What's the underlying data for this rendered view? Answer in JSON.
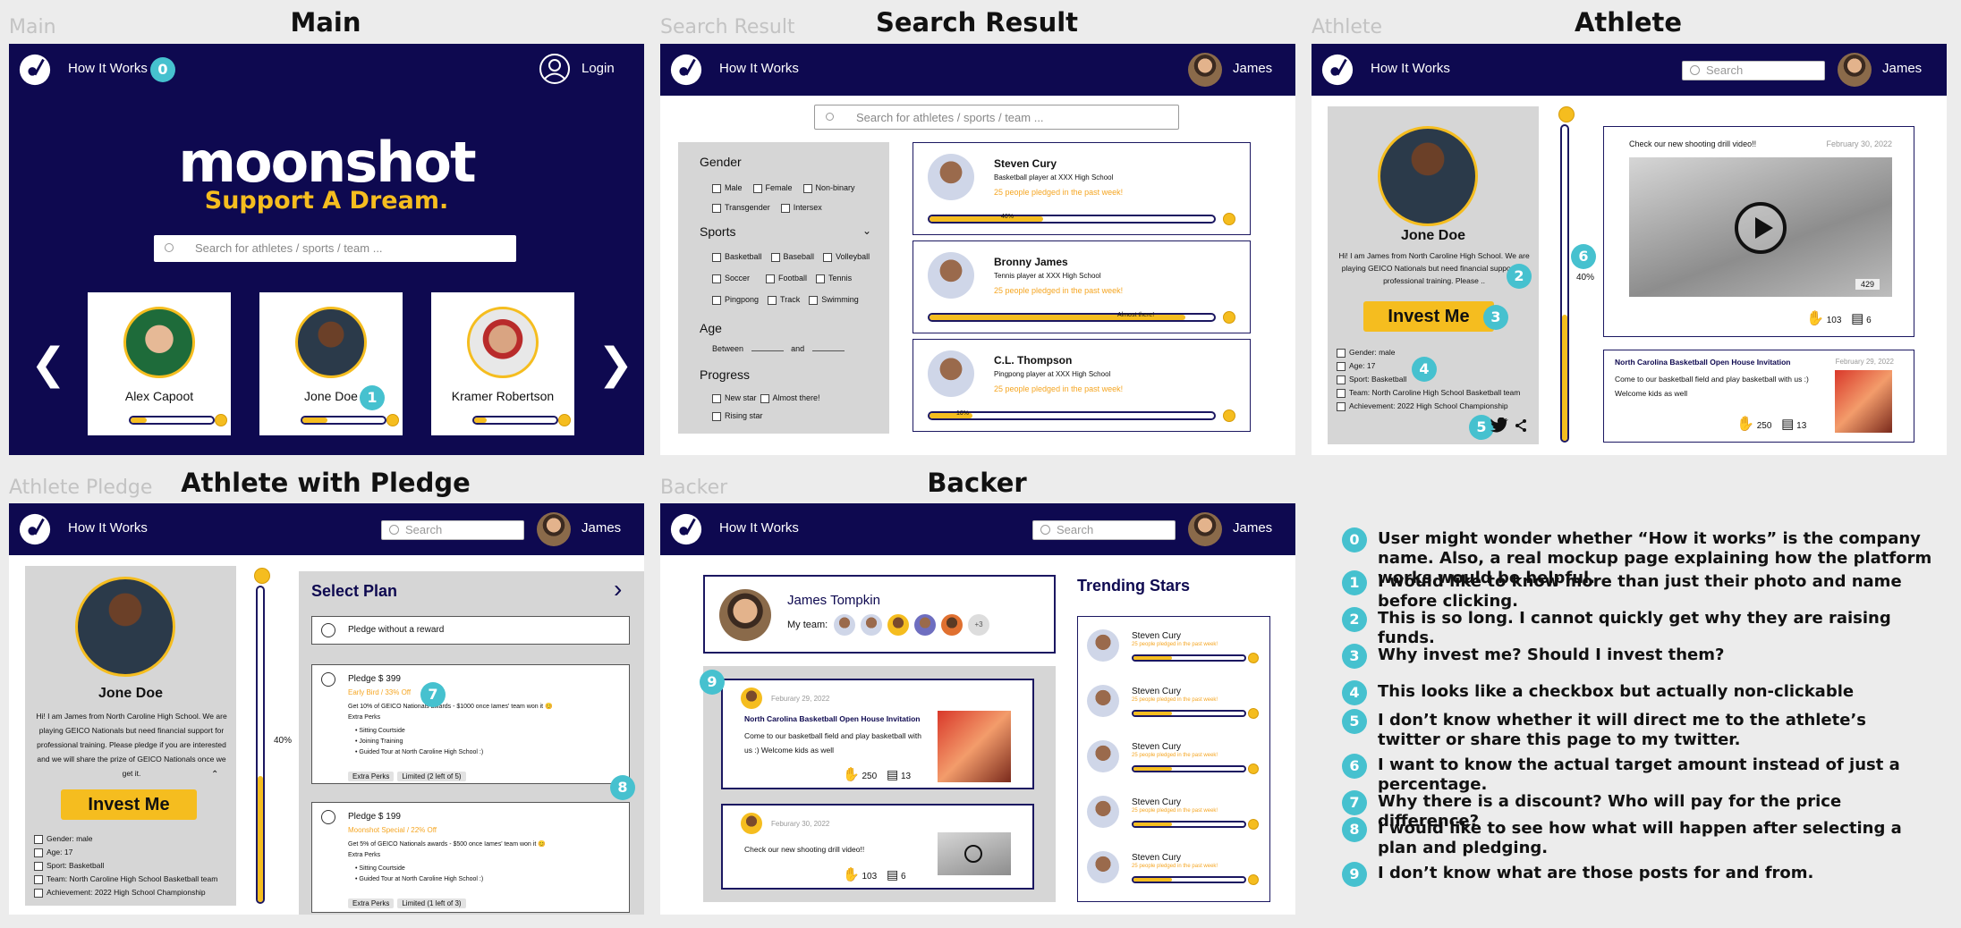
{
  "panels": {
    "main": {
      "label": "Main",
      "title": "Main"
    },
    "search": {
      "label": "Search Result",
      "title": "Search Result"
    },
    "athlete": {
      "label": "Athlete",
      "title": "Athlete"
    },
    "pledge": {
      "label": "Athlete Pledge",
      "title": "Athlete with Pledge"
    },
    "backer": {
      "label": "Backer",
      "title": "Backer"
    }
  },
  "nav": {
    "how_it_works": "How It Works",
    "login": "Login",
    "user": "James",
    "search_placeholder": "Search"
  },
  "main": {
    "brand": "moonshot",
    "tagline": "Support A Dream.",
    "search_placeholder": "Search for athletes / sports / team ...",
    "athletes": [
      "Alex Capoot",
      "Jone Doe",
      "Kramer Robertson"
    ]
  },
  "search": {
    "search_placeholder": "Search for athletes / sports / team ...",
    "filters": {
      "gender_title": "Gender",
      "gender": [
        "Male",
        "Female",
        "Non-binary",
        "Transgender",
        "Intersex"
      ],
      "sports_title": "Sports",
      "sports": [
        "Basketball",
        "Baseball",
        "Volleyball",
        "Soccer",
        "Football",
        "Tennis",
        "Pingpong",
        "Track",
        "Swimming"
      ],
      "age_title": "Age",
      "age_between": "Between",
      "age_and": "and",
      "progress_title": "Progress",
      "progress": [
        "New star",
        "Almost there!",
        "Rising star"
      ]
    },
    "results": [
      {
        "name": "Steven Cury",
        "desc": "Basketball player at XXX High School",
        "pledged": "25 people pledged in the past week!",
        "progress": 0.4,
        "bar_label": "40%"
      },
      {
        "name": "Bronny James",
        "desc": "Tennis player at XXX High School",
        "pledged": "25 people pledged in the past week!",
        "progress": 0.9,
        "bar_label": "Almost there!"
      },
      {
        "name": "C.L. Thompson",
        "desc": "Pingpong player at XXX High School",
        "pledged": "25 people pledged in the past week!",
        "progress": 0.15,
        "bar_label": "10%"
      }
    ]
  },
  "athlete": {
    "name": "Jone Doe",
    "bio": "Hi! I am James from North Caroline High School. We are playing GEICO Nationals but need financial support for professional training. Please ..",
    "invest": "Invest Me",
    "facts": [
      "Gender: male",
      "Age: 17",
      "Sport: Basketball",
      "Team: North Caroline High School Basketball team",
      "Achievement: 2022 High School Championship"
    ],
    "progress": 0.4,
    "progress_label": "40%",
    "post1": {
      "text": "Check our new shooting drill video!!",
      "date": "February 30, 2022",
      "views": "429",
      "claps": "103",
      "comments": "6"
    },
    "post2": {
      "title": "North Carolina Basketball Open House Invitation",
      "date": "February 29, 2022",
      "text": "Come to our basketball field and play basketball with us :) Welcome kids as well",
      "claps": "250",
      "comments": "13"
    }
  },
  "pledge": {
    "name": "Jone Doe",
    "bio": "Hi! I am James from North Caroline High School. We are playing GEICO Nationals but need financial support for professional training. Please pledge if you are interested and we will share the prize of GEICO Nationals once we get it.",
    "invest": "Invest Me",
    "facts": [
      "Gender: male",
      "Age: 17",
      "Sport: Basketball",
      "Team: North Caroline High School Basketball team",
      "Achievement: 2022 High School Championship"
    ],
    "progress_label": "40%",
    "progress": 0.4,
    "select_plan": "Select Plan",
    "no_reward": "Pledge without a reward",
    "plans": [
      {
        "title": "Pledge $ 399",
        "promo": "Early Bird / 33% Off",
        "desc": "Get 10% of GEICO Nationals awards - $1000 once Iames' team won it 😊",
        "extra": "Extra Perks",
        "perks": [
          "Sitting Courtside",
          "Joining Training",
          "Guided Tour at North Caroline High School :)"
        ],
        "tag1": "Extra Perks",
        "tag2": "Limited (2 left of 5)"
      },
      {
        "title": "Pledge $ 199",
        "promo": "Moonshot Special / 22% Off",
        "desc": "Get 5% of GEICO Nationals awards - $500 once Iames' team won it 😊",
        "extra": "Extra Perks",
        "perks": [
          "Sitting Courtside",
          "Guided Tour at North Caroline High School :)"
        ],
        "tag1": "Extra Perks",
        "tag2": "Limited (1 left of 3)"
      }
    ]
  },
  "backer": {
    "name": "James Tompkin",
    "team_label": "My team:",
    "team_more": "+3",
    "trending_title": "Trending Stars",
    "trending": [
      {
        "name": "Steven Cury",
        "pledged": "25 people pledged in the past week!",
        "progress": 0.35
      },
      {
        "name": "Steven Cury",
        "pledged": "25 people pledged in the past week!",
        "progress": 0.35
      },
      {
        "name": "Steven Cury",
        "pledged": "25 people pledged in the past week!",
        "progress": 0.35
      },
      {
        "name": "Steven Cury",
        "pledged": "25 people pledged in the past week!",
        "progress": 0.35
      },
      {
        "name": "Steven Cury",
        "pledged": "25 people pledged in the past week!",
        "progress": 0.35
      }
    ],
    "feed1": {
      "date": "Feburary 29, 2022",
      "title": "North Carolina Basketball Open House Invitation",
      "text": "Come to our basketball field and play basketball with us :) Welcome kids as well",
      "claps": "250",
      "comments": "13"
    },
    "feed2": {
      "date": "Feburary 30, 2022",
      "text": "Check our new shooting drill video!!",
      "claps": "103",
      "comments": "6"
    }
  },
  "badges": [
    "0",
    "1",
    "2",
    "3",
    "4",
    "5",
    "6",
    "7",
    "8",
    "9"
  ],
  "notes": [
    {
      "n": "0",
      "text": "User might wonder whether “How it works” is the company name. Also, a real mockup page explaining how the platform works would be helpful."
    },
    {
      "n": "1",
      "text": "I would like to know more than just their photo and name before clicking."
    },
    {
      "n": "2",
      "text": "This is so long. I cannot quickly get why they are raising funds."
    },
    {
      "n": "3",
      "text": "Why invest me? Should I invest them?"
    },
    {
      "n": "4",
      "text": "This looks like a checkbox but actually non-clickable"
    },
    {
      "n": "5",
      "text": "I don’t know whether it will direct me to the athlete’s twitter or share this page to my twitter."
    },
    {
      "n": "6",
      "text": "I want to know the actual target amount instead of just a percentage."
    },
    {
      "n": "7",
      "text": "Why there is a discount? Who will pay for the price difference?"
    },
    {
      "n": "8",
      "text": "I would like to see how what will happen after selecting a plan and pledging."
    },
    {
      "n": "9",
      "text": "I don’t know what are those posts for and from."
    }
  ],
  "colors": {
    "navy": "#0e0950",
    "accent": "#f5bd1f",
    "badge": "#46c1cf",
    "promo": "#f5a623"
  }
}
